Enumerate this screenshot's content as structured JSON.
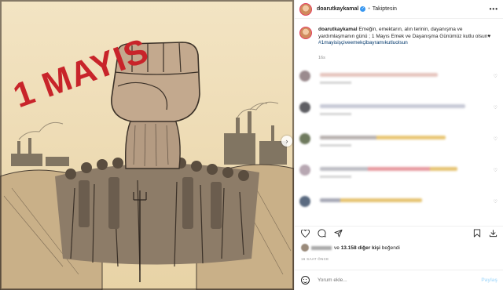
{
  "post_image": {
    "headline_text": "1 MAYIS",
    "nav_icon": "chevron-right-icon"
  },
  "header": {
    "username": "doarutkaykamal",
    "verified_icon": "verified-badge-icon",
    "separator": "•",
    "follow_status": "Takiptesin",
    "more_icon": "more-horizontal-icon",
    "more_glyph": "•••"
  },
  "caption": {
    "username": "doarutkaykamal",
    "text": "Emeğin, emektarın, alın terinin, dayanışma ve yardımlaşmanın günü ; 1 Mayıs Emek ve Dayanışma Günümüz kutlu olsun♥",
    "hashtags": "#1mayisişçiveemekçibayramıkutluolsun",
    "time": "16s"
  },
  "comments": [
    {
      "bar_color": "#e6c6bf",
      "bar_width": 0
    },
    {
      "bar_color": "#c7c9d6",
      "bar_width": 0
    },
    {
      "bar_color": "#e9c776",
      "bar_width": 0
    },
    {
      "bar_color": "#e79aa0",
      "bar_width": 0
    },
    {
      "bar_color": "#e6c474",
      "bar_width": 0
    }
  ],
  "actions": {
    "like_icon": "heart-icon",
    "comment_icon": "comment-icon",
    "share_icon": "send-icon",
    "bookmark_icon": "bookmark-icon",
    "save_icon": "download-icon"
  },
  "likes": {
    "connector": "ve",
    "count_text": "13.158 diğer kişi",
    "suffix": "beğendi"
  },
  "post_time": "16 SAAT ÖNCE",
  "add_comment": {
    "emoji_icon": "emoji-icon",
    "placeholder": "Yorum ekle...",
    "post_label": "Paylaş"
  },
  "colors": {
    "accent": "#3897f0",
    "poster_bg": "#f1e1bd",
    "headline_red": "#c8242a"
  }
}
